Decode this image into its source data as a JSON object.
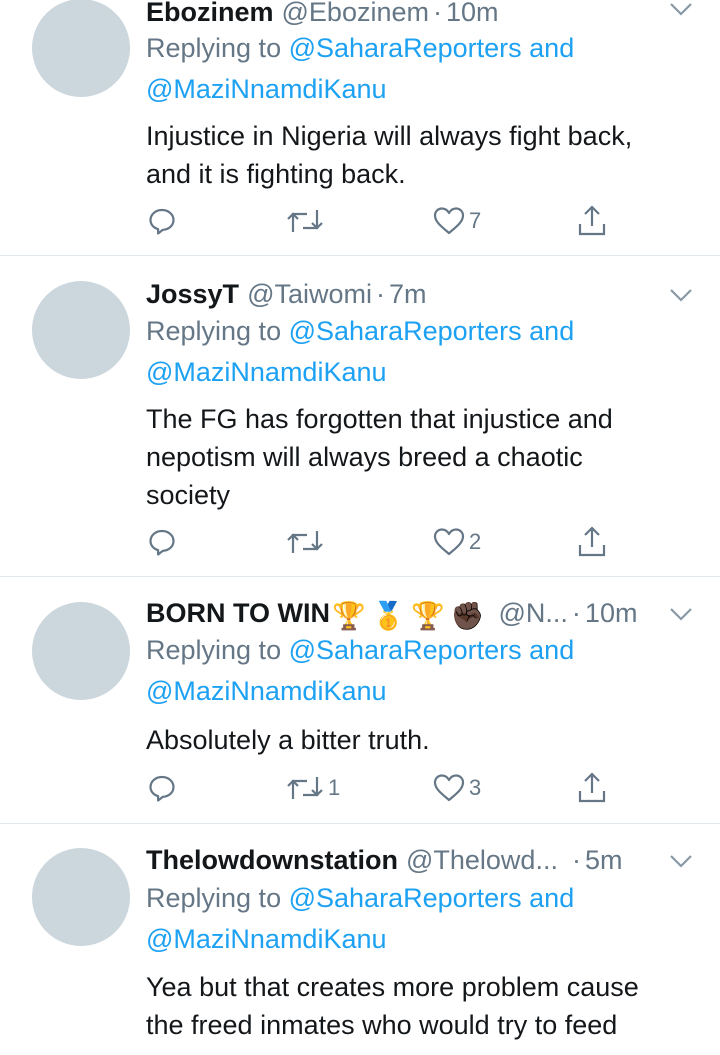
{
  "colors": {
    "link": "#1da1f2",
    "muted": "#657786",
    "text": "#14171a",
    "avatar": "#ccd6dd",
    "divider": "#e1e8ed"
  },
  "icons": {
    "reply": "reply-icon",
    "retweet": "retweet-icon",
    "like": "heart-icon",
    "share": "share-icon",
    "menu": "chevron-down-icon"
  },
  "tweets": [
    {
      "name": "Ebozinem",
      "handle": "@Ebozinem",
      "dot": "·",
      "time": "10m",
      "replying_prefix": "Replying to",
      "replying_to_1": "@SaharaReporters",
      "replying_and": "and",
      "replying_to_2": "@MaziNnamdiKanu",
      "text_lines": [
        "Injustice in Nigeria will always fight back,",
        "and it is fighting back."
      ],
      "retweets": "",
      "likes": "7"
    },
    {
      "name": "JossyT",
      "handle": "@Taiwomi",
      "dot": "·",
      "time": "7m",
      "replying_prefix": "Replying to",
      "replying_to_1": "@SaharaReporters",
      "replying_and": "and",
      "replying_to_2": "@MaziNnamdiKanu",
      "text_lines": [
        "The FG has forgotten that injustice and",
        "nepotism will always breed a chaotic",
        "society"
      ],
      "retweets": "",
      "likes": "2"
    },
    {
      "name": "BORN TO WIN",
      "name_emojis": [
        "🏆",
        "🥇",
        "🏆",
        "✊🏿"
      ],
      "handle": "@N...",
      "dot": "·",
      "time": "10m",
      "replying_prefix": "Replying to",
      "replying_to_1": "@SaharaReporters",
      "replying_and": "and",
      "replying_to_2": "@MaziNnamdiKanu",
      "text_lines": [
        "Absolutely a bitter truth."
      ],
      "retweets": "1",
      "likes": "3"
    },
    {
      "name": "Thelowdownstation",
      "handle": "@Thelowd...",
      "dot": "·",
      "time": "5m",
      "replying_prefix": "Replying to",
      "replying_to_1": "@SaharaReporters",
      "replying_and": "and",
      "replying_to_2": "@MaziNnamdiKanu",
      "text_lines": [
        "Yea but that creates more problem cause",
        "the freed inmates who would try to feed"
      ],
      "retweets": "",
      "likes": ""
    }
  ]
}
